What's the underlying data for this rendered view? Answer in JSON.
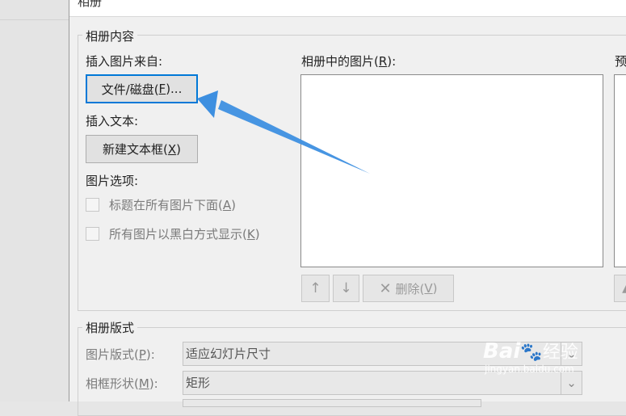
{
  "dialog": {
    "title": "相册"
  },
  "album_content": {
    "group_label": "相册内容",
    "insert_from_label": "插入图片来自:",
    "file_disk_button": {
      "text": "文件/磁盘(",
      "key": "F",
      "suffix": ")..."
    },
    "insert_text_label": "插入文本:",
    "new_textbox_button": {
      "text": "新建文本框(",
      "key": "X",
      "suffix": ")"
    },
    "picture_options_label": "图片选项:",
    "captions_below": {
      "text": "标题在所有图片下面(",
      "key": "A",
      "suffix": ")",
      "checked": false
    },
    "all_black_white": {
      "text": "所有图片以黑白方式显示(",
      "key": "K",
      "suffix": ")",
      "checked": false
    },
    "pictures_in_album_label": {
      "text": "相册中的图片(",
      "key": "R",
      "suffix": "):"
    },
    "preview_label": "预",
    "move_up_icon": "↑",
    "move_down_icon": "↓",
    "delete_button": {
      "icon": "✕",
      "text": "删除(",
      "key": "V",
      "suffix": ")"
    }
  },
  "album_layout": {
    "group_label": "相册版式",
    "picture_layout": {
      "label": "图片版式(",
      "key": "P",
      "suffix": "):",
      "value": "适应幻灯片尺寸"
    },
    "frame_shape": {
      "label": "相框形状(",
      "key": "M",
      "suffix": "):",
      "value": "矩形"
    }
  },
  "watermark": {
    "brand": "Bai",
    "brand_suffix": "经验",
    "url": "jingyan.baidu.com"
  },
  "colors": {
    "arrow": "#3d8fe0",
    "focus": "#0078d7"
  }
}
